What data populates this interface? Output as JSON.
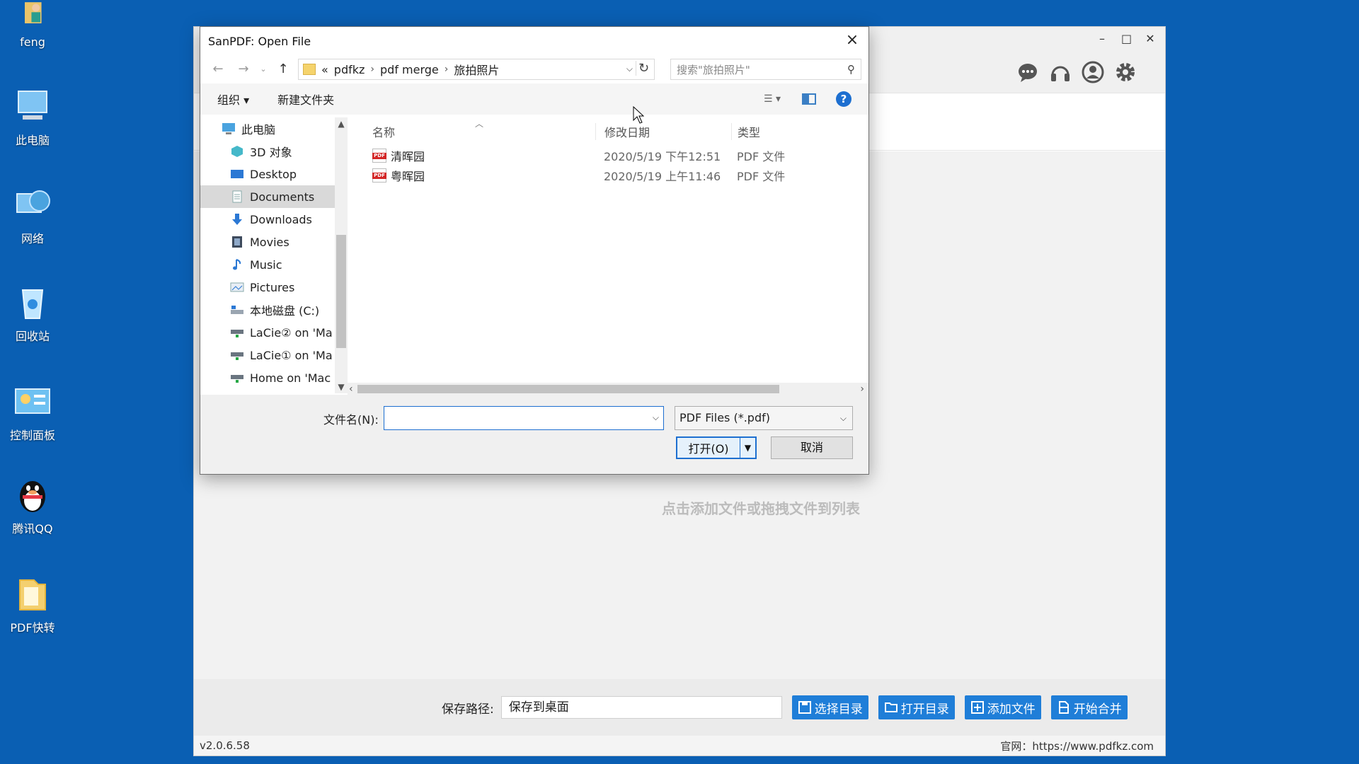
{
  "desktop": {
    "icons": [
      {
        "label": "feng",
        "icon": "user-folder-icon"
      },
      {
        "label": "此电脑",
        "icon": "computer-icon"
      },
      {
        "label": "网络",
        "icon": "network-icon"
      },
      {
        "label": "回收站",
        "icon": "recycle-bin-icon"
      },
      {
        "label": "控制面板",
        "icon": "control-panel-icon"
      },
      {
        "label": "腾讯QQ",
        "icon": "qq-icon"
      },
      {
        "label": "PDF快转",
        "icon": "folder-icon"
      }
    ]
  },
  "app": {
    "drop_hint": "点击添加文件或拖拽文件到列表",
    "save_path_label": "保存路径:",
    "save_path_value": "保存到桌面",
    "buttons": {
      "choose_dir": "选择目录",
      "open_dir": "打开目录",
      "add_file": "添加文件",
      "start_merge": "开始合并"
    },
    "version": "v2.0.6.58",
    "website": "官网：https://www.pdfkz.com",
    "accent_color": "#1f7ed8"
  },
  "dialog": {
    "title": "SanPDF: Open File",
    "breadcrumb": {
      "overflow": "«",
      "items": [
        "pdfkz",
        "pdf merge",
        "旅拍照片"
      ]
    },
    "search_placeholder": "搜索\"旅拍照片\"",
    "toolbar": {
      "organize": "组织 ▾",
      "new_folder": "新建文件夹",
      "help": "?"
    },
    "nav_items": [
      {
        "label": "此电脑",
        "icon": "computer-icon"
      },
      {
        "label": "3D 对象",
        "icon": "3d-objects-icon"
      },
      {
        "label": "Desktop",
        "icon": "desktop-icon"
      },
      {
        "label": "Documents",
        "icon": "documents-icon"
      },
      {
        "label": "Downloads",
        "icon": "downloads-icon"
      },
      {
        "label": "Movies",
        "icon": "movies-icon"
      },
      {
        "label": "Music",
        "icon": "music-icon"
      },
      {
        "label": "Pictures",
        "icon": "pictures-icon"
      },
      {
        "label": "本地磁盘 (C:)",
        "icon": "drive-icon"
      },
      {
        "label": "LaCie② on 'Ma",
        "icon": "network-drive-icon"
      },
      {
        "label": "LaCie① on 'Ma",
        "icon": "network-drive-icon"
      },
      {
        "label": "Home on 'Mac",
        "icon": "network-drive-icon"
      }
    ],
    "columns": {
      "name": "名称",
      "date": "修改日期",
      "type": "类型"
    },
    "files": [
      {
        "name": "清晖园",
        "date": "2020/5/19 下午12:51",
        "type": "PDF 文件"
      },
      {
        "name": "粤晖园",
        "date": "2020/5/19 上午11:46",
        "type": "PDF 文件"
      }
    ],
    "filename_label": "文件名(N):",
    "filename_value": "",
    "filetype_value": "PDF Files (*.pdf)",
    "open_button": "打开(O)",
    "cancel_button": "取消"
  }
}
